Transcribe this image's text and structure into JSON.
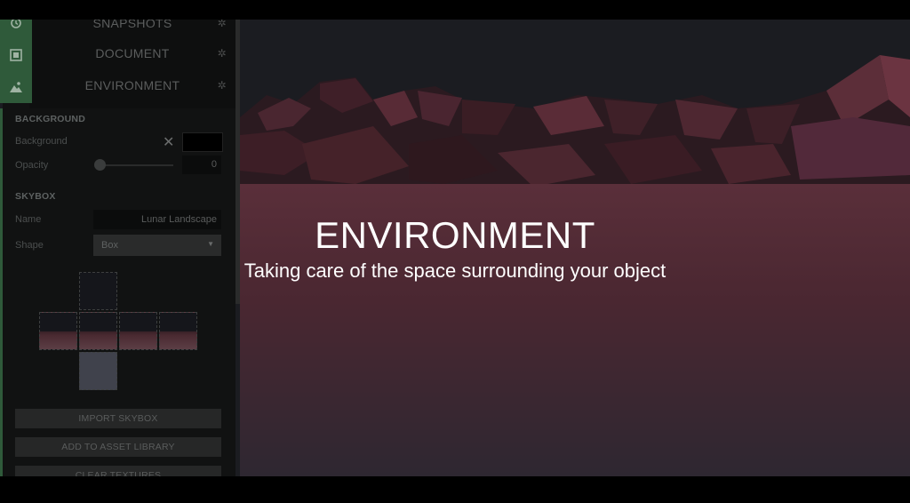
{
  "nav": {
    "items": [
      {
        "label": "SNAPSHOTS",
        "icon": "history-icon"
      },
      {
        "label": "DOCUMENT",
        "icon": "document-icon"
      },
      {
        "label": "ENVIRONMENT",
        "icon": "landscape-icon"
      }
    ]
  },
  "background": {
    "heading": "BACKGROUND",
    "color_label": "Background",
    "color_value": "#000000",
    "opacity_label": "Opacity",
    "opacity_value": "0"
  },
  "skybox": {
    "heading": "SKYBOX",
    "name_label": "Name",
    "name_value": "Lunar Landscape",
    "shape_label": "Shape",
    "shape_value": "Box"
  },
  "buttons": {
    "import": "IMPORT SKYBOX",
    "add_library": "ADD TO ASSET LIBRARY",
    "clear": "CLEAR TEXTURES"
  },
  "overlay": {
    "title": "ENVIRONMENT",
    "subtitle": "Taking care of the space surrounding your object"
  },
  "colors": {
    "accent": "#2f5a3a",
    "ground": "#6e3a47",
    "sky": "#1c1d22"
  }
}
